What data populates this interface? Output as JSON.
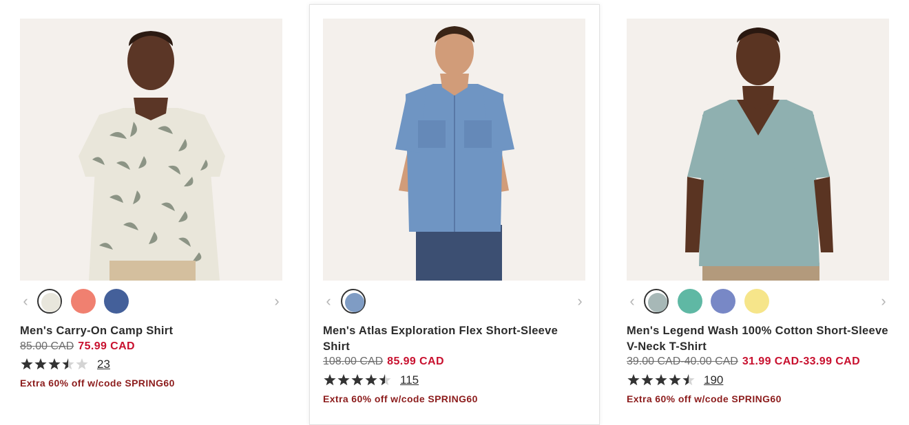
{
  "products": [
    {
      "name": "Men's Carry-On Camp Shirt",
      "old_price": "85.00 CAD",
      "new_price": "75.99 CAD",
      "rating": 3.5,
      "review_count": "23",
      "promo": "Extra 60% off w/code SPRING60",
      "swatches": [
        "#e8e6dc",
        "#f08070",
        "#44609a"
      ],
      "selected_swatch": 0
    },
    {
      "name": "Men's Atlas Exploration Flex Short-Sleeve Shirt",
      "old_price": "108.00 CAD",
      "new_price": "85.99 CAD",
      "rating": 4.5,
      "review_count": "115",
      "promo": "Extra 60% off w/code SPRING60",
      "swatches": [
        "#7f9cc4"
      ],
      "selected_swatch": 0
    },
    {
      "name": "Men's Legend Wash 100% Cotton Short-Sleeve V-Neck T-Shirt",
      "old_price": "39.00 CAD-40.00 CAD",
      "new_price": "31.99 CAD-33.99 CAD",
      "rating": 4.5,
      "review_count": "190",
      "promo": "Extra 60% off w/code SPRING60",
      "swatches": [
        "#a7b8b7",
        "#5fb8a4",
        "#7888c6",
        "#f6e58a"
      ],
      "selected_swatch": 0
    }
  ],
  "colors": {
    "sale_red": "#c8102e",
    "promo_red": "#8c1c1c",
    "image_bg": "#f4f0ec"
  },
  "icons": {
    "prev": "chevron-left-icon",
    "next": "chevron-right-icon",
    "star": "star-icon"
  }
}
